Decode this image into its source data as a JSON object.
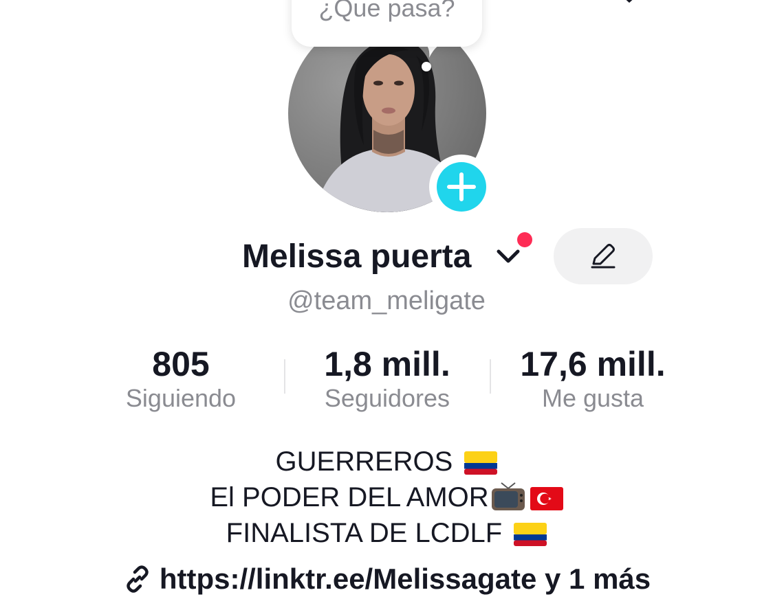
{
  "bubble": {
    "text": "¿Que pasa?"
  },
  "profile": {
    "display_name": "Melissa puerta",
    "username": "@team_meligate"
  },
  "stats": {
    "following": {
      "value": "805",
      "label": "Siguiendo"
    },
    "followers": {
      "value": "1,8 mill.",
      "label": "Seguidores"
    },
    "likes": {
      "value": "17,6 mill.",
      "label": "Me gusta"
    }
  },
  "bio": {
    "line1": "GUERREROS",
    "line2": "El PODER DEL AMOR",
    "line3": "FINALISTA DE LCDLF"
  },
  "link": {
    "url": "https://linktr.ee/Melissagate",
    "more": "y 1 más"
  },
  "icons": {
    "edit": "pencil-icon",
    "link": "link-icon",
    "add": "plus-icon",
    "chevron": "chevron-down-icon",
    "flags": [
      "colombia-flag-icon",
      "tv-icon",
      "turkey-flag-icon",
      "colombia-flag-icon"
    ]
  },
  "colors": {
    "accent_add": "#20d5ec",
    "notification_dot": "#fe2c55",
    "secondary_text": "#8a8b91",
    "primary_text": "#161823"
  }
}
